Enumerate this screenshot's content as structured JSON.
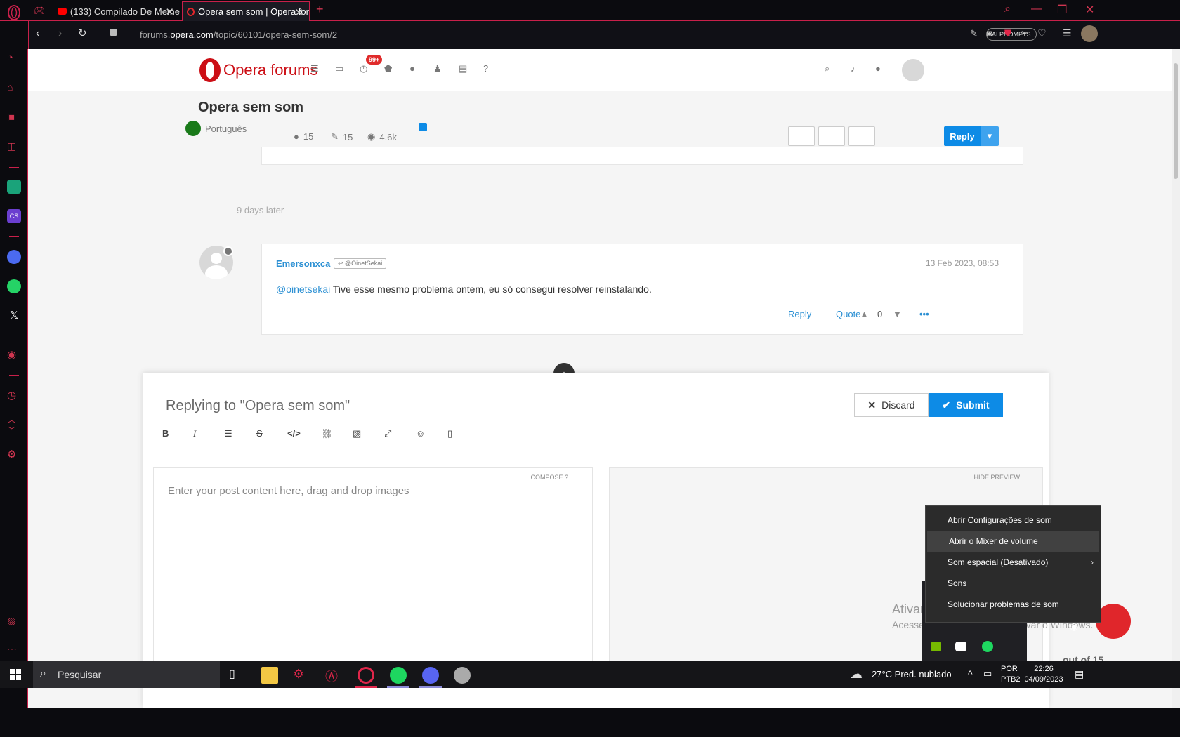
{
  "browser": {
    "tabs": [
      {
        "label": "(133) Compilado De Meme"
      },
      {
        "label": "Opera sem som | Opera for"
      }
    ],
    "url_prefix": "forums.",
    "url_domain": "opera.com",
    "url_path": "/topic/60101/opera-sem-som/2",
    "ai_prompts": "AI PROMPTS"
  },
  "forum": {
    "logo_brand": "Opera",
    "logo_forums": "forums",
    "notif_badge": "99+",
    "topic_title": "Opera sem som",
    "category": "Português",
    "posters": "15",
    "posts": "15",
    "views": "4.6k",
    "reply_label": "Reply",
    "days_later": "9 days later",
    "post": {
      "author": "Emersonxca",
      "reply_to": "@OinetSekai",
      "date": "13 Feb 2023, 08:53",
      "mention": "@oinetsekai",
      "text": " Tive esse mesmo problema ontem, eu só consegui resolver reinstalando.",
      "reply": "Reply",
      "quote": "Quote",
      "votes": "0"
    }
  },
  "composer": {
    "title": "Replying to \"Opera sem som\"",
    "discard": "Discard",
    "submit": "Submit",
    "compose_label": "COMPOSE",
    "placeholder": "Enter your post content here, drag and drop images",
    "hide_preview": "HIDE PREVIEW",
    "out_of": "out of 15"
  },
  "watermark": {
    "line1": "Ativar o Windows",
    "line2": "Acesse Configurações para ativar o Windows."
  },
  "context_menu": {
    "items": [
      {
        "label": "Abrir Configurações de som"
      },
      {
        "label": "Abrir o Mixer de volume"
      },
      {
        "label": "Som espacial (Desativado)"
      },
      {
        "label": "Sons"
      },
      {
        "label": "Solucionar problemas de som"
      }
    ]
  },
  "taskbar": {
    "search": "Pesquisar",
    "weather": "27°C  Pred. nublado",
    "lang1": "POR",
    "lang2": "PTB2",
    "time": "22:26",
    "date": "04/09/2023"
  },
  "colors": {
    "opera_red": "#cc0f16",
    "accent_blue": "#0d8be6",
    "browser_border": "#c8204a"
  }
}
